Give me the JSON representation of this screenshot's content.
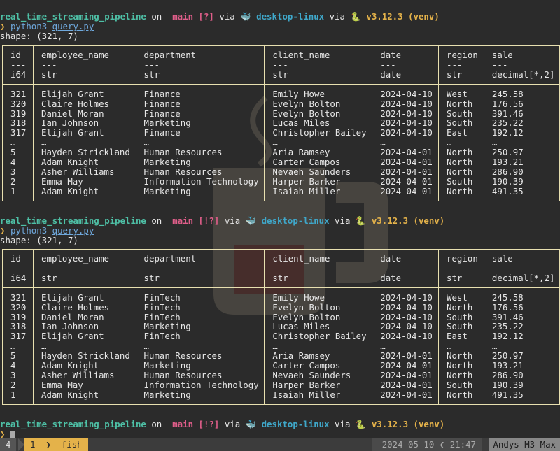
{
  "prompt": {
    "dir": "real_time_streaming_pipeline",
    "on": "on",
    "branch_icon": "",
    "branch": "main",
    "via": "via",
    "host": "desktop-linux",
    "py": "v3.12.3 (venv)",
    "arrow": "❯"
  },
  "blocks": [
    {
      "status": "[?]",
      "cmd": "python3",
      "arg": "query.py",
      "shape": "shape: (321, 7)",
      "columns": [
        "id",
        "employee_name",
        "department",
        "client_name",
        "date",
        "region",
        "sale"
      ],
      "dashes": [
        "---",
        "---",
        "---",
        "---",
        "---",
        "---",
        "---"
      ],
      "dtypes": [
        "i64",
        "str",
        "str",
        "str",
        "date",
        "str",
        "decimal[*,2]"
      ],
      "rows": [
        [
          "321",
          "Elijah Grant",
          "Finance",
          "Emily Howe",
          "2024-04-10",
          "West",
          "245.58"
        ],
        [
          "320",
          "Claire Holmes",
          "Finance",
          "Evelyn Bolton",
          "2024-04-10",
          "North",
          "176.56"
        ],
        [
          "319",
          "Daniel Moran",
          "Finance",
          "Evelyn Bolton",
          "2024-04-10",
          "South",
          "391.46"
        ],
        [
          "318",
          "Ian Johnson",
          "Marketing",
          "Lucas Miles",
          "2024-04-10",
          "South",
          "235.22"
        ],
        [
          "317",
          "Elijah Grant",
          "Finance",
          "Christopher Bailey",
          "2024-04-10",
          "East",
          "192.12"
        ],
        [
          "…",
          "…",
          "…",
          "…",
          "…",
          "…",
          "…"
        ],
        [
          "5",
          "Hayden Strickland",
          "Human Resources",
          "Aria Ramsey",
          "2024-04-01",
          "North",
          "250.97"
        ],
        [
          "4",
          "Adam Knight",
          "Marketing",
          "Carter Campos",
          "2024-04-01",
          "North",
          "193.21"
        ],
        [
          "3",
          "Asher Williams",
          "Human Resources",
          "Nevaeh Saunders",
          "2024-04-01",
          "North",
          "286.90"
        ],
        [
          "2",
          "Emma May",
          "Information Technology",
          "Harper Barker",
          "2024-04-01",
          "South",
          "190.39"
        ],
        [
          "1",
          "Adam Knight",
          "Marketing",
          "Isaiah Miller",
          "2024-04-01",
          "North",
          "491.35"
        ]
      ]
    },
    {
      "status": "[!?]",
      "cmd": "python3",
      "arg": "query.py",
      "shape": "shape: (321, 7)",
      "columns": [
        "id",
        "employee_name",
        "department",
        "client_name",
        "date",
        "region",
        "sale"
      ],
      "dashes": [
        "---",
        "---",
        "---",
        "---",
        "---",
        "---",
        "---"
      ],
      "dtypes": [
        "i64",
        "str",
        "str",
        "str",
        "date",
        "str",
        "decimal[*,2]"
      ],
      "rows": [
        [
          "321",
          "Elijah Grant",
          "FinTech",
          "Emily Howe",
          "2024-04-10",
          "West",
          "245.58"
        ],
        [
          "320",
          "Claire Holmes",
          "FinTech",
          "Evelyn Bolton",
          "2024-04-10",
          "North",
          "176.56"
        ],
        [
          "319",
          "Daniel Moran",
          "FinTech",
          "Evelyn Bolton",
          "2024-04-10",
          "South",
          "391.46"
        ],
        [
          "318",
          "Ian Johnson",
          "Marketing",
          "Lucas Miles",
          "2024-04-10",
          "South",
          "235.22"
        ],
        [
          "317",
          "Elijah Grant",
          "FinTech",
          "Christopher Bailey",
          "2024-04-10",
          "East",
          "192.12"
        ],
        [
          "…",
          "…",
          "…",
          "…",
          "…",
          "…",
          "…"
        ],
        [
          "5",
          "Hayden Strickland",
          "Human Resources",
          "Aria Ramsey",
          "2024-04-01",
          "North",
          "250.97"
        ],
        [
          "4",
          "Adam Knight",
          "Marketing",
          "Carter Campos",
          "2024-04-01",
          "North",
          "193.21"
        ],
        [
          "3",
          "Asher Williams",
          "Human Resources",
          "Nevaeh Saunders",
          "2024-04-01",
          "North",
          "286.90"
        ],
        [
          "2",
          "Emma May",
          "Information Technology",
          "Harper Barker",
          "2024-04-01",
          "South",
          "190.39"
        ],
        [
          "1",
          "Adam Knight",
          "Marketing",
          "Isaiah Miller",
          "2024-04-01",
          "North",
          "491.35"
        ]
      ]
    }
  ],
  "final_prompt": {
    "status": "[!?]"
  },
  "statusbar": {
    "window_index": "4",
    "tab_index": "1",
    "tab_name": "fish",
    "date": "2024-05-10",
    "time": "21:47",
    "host": "Andys-M3-Max"
  },
  "colors": {
    "background": "#2b2b2b",
    "table_border": "#e8e0b0",
    "accent": "#e4b24a"
  }
}
